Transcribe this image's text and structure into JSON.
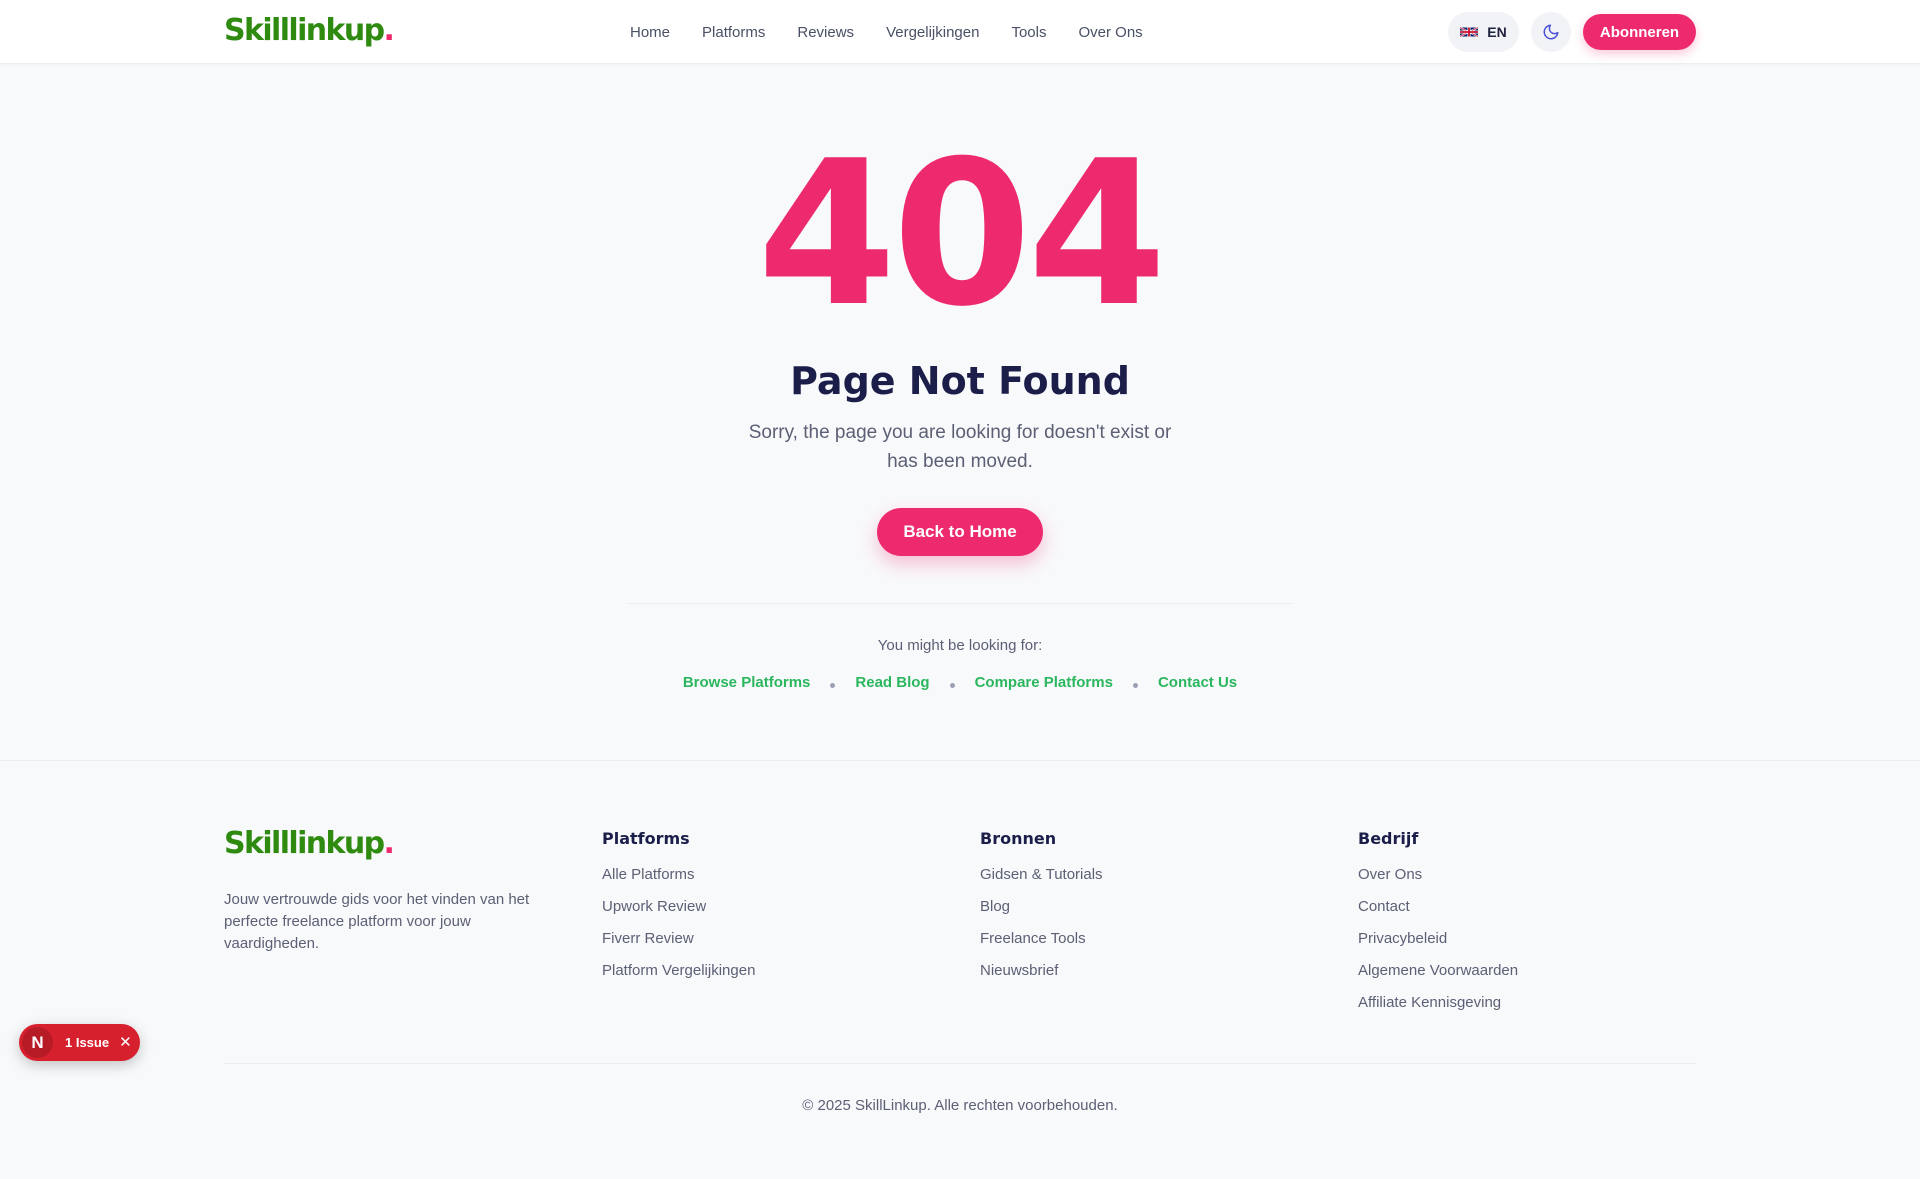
{
  "header": {
    "logo_text": "Skilllinkup",
    "logo_dot": ".",
    "nav": [
      "Home",
      "Platforms",
      "Reviews",
      "Vergelijkingen",
      "Tools",
      "Over Ons"
    ],
    "lang_label": "EN",
    "subscribe_label": "Abonneren"
  },
  "main": {
    "code": "404",
    "title": "Page Not Found",
    "description": "Sorry, the page you are looking for doesn't exist or has been moved.",
    "back_home_label": "Back to Home",
    "hint": "You might be looking for:",
    "suggestions": [
      "Browse Platforms",
      "Read Blog",
      "Compare Platforms",
      "Contact Us"
    ]
  },
  "footer": {
    "logo_text": "Skilllinkup",
    "logo_dot": ".",
    "about": "Jouw vertrouwde gids voor het vinden van het perfecte freelance platform voor jouw vaardigheden.",
    "columns": [
      {
        "title": "Platforms",
        "links": [
          "Alle Platforms",
          "Upwork Review",
          "Fiverr Review",
          "Platform Vergelijkingen"
        ]
      },
      {
        "title": "Bronnen",
        "links": [
          "Gidsen & Tutorials",
          "Blog",
          "Freelance Tools",
          "Nieuwsbrief"
        ]
      },
      {
        "title": "Bedrijf",
        "links": [
          "Over Ons",
          "Contact",
          "Privacybeleid",
          "Algemene Voorwaarden",
          "Affiliate Kennisgeving"
        ]
      }
    ],
    "copyright": "© 2025 SkillLinkup. Alle rechten voorbehouden."
  },
  "dev_overlay": {
    "icon_letter": "N",
    "issue_label": "1 Issue",
    "close_glyph": "✕"
  },
  "colors": {
    "accent": "#ee2a6e",
    "brand_green": "#2e8b10",
    "link_green": "#2bb75e",
    "heading": "#1c1e4a",
    "issue_red": "#d7202e"
  },
  "icons": {
    "flag": "uk-flag-icon",
    "theme": "moon-icon",
    "issue": "nextjs-icon",
    "close": "close-icon"
  }
}
